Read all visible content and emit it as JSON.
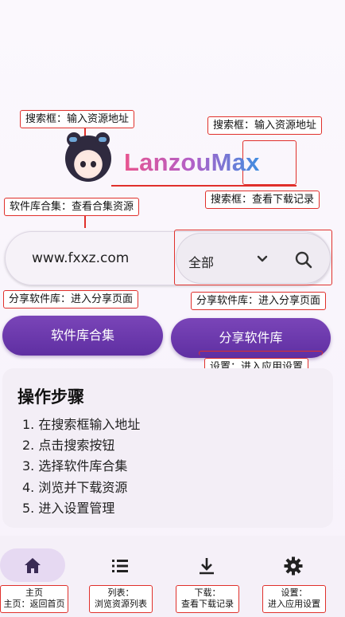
{
  "header": {
    "brand": "LanzouMax"
  },
  "annotations": {
    "search_top_left": "搜索框：输入资源地址",
    "search_top_right": "搜索框：输入资源地址",
    "search_download_record": "搜索框：查看下载记录",
    "collection_view": "软件库合集：查看合集资源",
    "share_left": "分享软件库：进入分享页面",
    "share_right": "分享软件库：进入分享页面",
    "settings": "设置：进入应用设置"
  },
  "search": {
    "value": "www.fxxz.com",
    "filter_selected": "全部"
  },
  "buttons": {
    "collection": "软件库合集",
    "share": "分享软件库"
  },
  "steps": {
    "title": "操作步骤",
    "items": [
      "1. 在搜索框输入地址",
      "2. 点击搜索按钮",
      "3. 选择软件库合集",
      "4. 浏览并下载资源",
      "5. 进入设置管理"
    ]
  },
  "nav": {
    "home_title": "主页",
    "home_desc": "主页：返回首页",
    "list_title": "列表：",
    "list_desc": "浏览资源列表",
    "download_title": "下载：",
    "download_desc": "查看下载记录",
    "settings_title": "设置：",
    "settings_desc": "进入应用设置"
  },
  "colors": {
    "primary": "#6a38ad",
    "annotation": "#e0302b"
  }
}
